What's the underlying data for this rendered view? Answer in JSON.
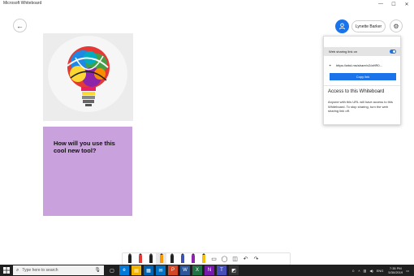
{
  "window": {
    "title": "Microsoft Whiteboard",
    "minimize": "—",
    "maximize": "☐",
    "close": "✕"
  },
  "header": {
    "back_icon": "←",
    "user_name": "Lynette Barker",
    "settings_icon": "⚙"
  },
  "sticky_note": {
    "text": "How will you use this cool new tool?",
    "color": "#c9a1dc"
  },
  "share_panel": {
    "toggle_label": "Web sharing link on",
    "toggle_on": true,
    "link": "https://wbd.ms/share/v2/aHR0...",
    "copy_button": "Copy link",
    "access_title": "Access to this Whiteboard",
    "access_description": "Anyone with this URL will have access to this Whiteboard. To stop sharing, turn the web sharing link off."
  },
  "toolbar": {
    "pen_colors": [
      "#222222",
      "#e53935",
      "#222222",
      "#ff9800",
      "#222222",
      "#3f51b5",
      "#8e24aa",
      "#f4c20d"
    ],
    "tools": [
      "ruler-icon",
      "lasso-icon",
      "shapes-icon",
      "undo-icon",
      "redo-icon"
    ]
  },
  "taskbar": {
    "search_placeholder": "Type here to search",
    "time": "7:35 PM",
    "date": "5/30/2019",
    "language": "ENG"
  },
  "colors": {
    "accent": "#1a73e8",
    "taskbar": "#1f1f1f"
  }
}
